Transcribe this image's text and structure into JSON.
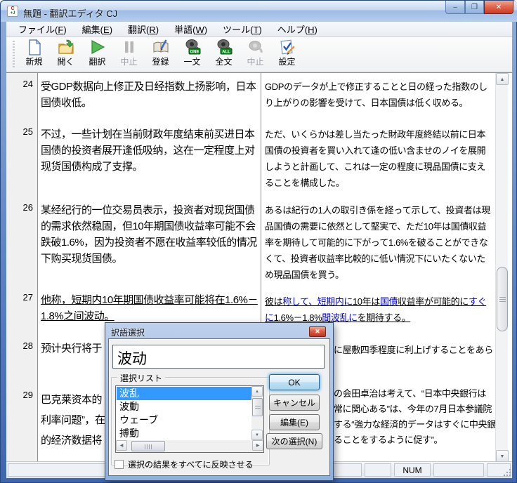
{
  "window": {
    "title": "無題 - 翻訳エディタ CJ",
    "controls": {
      "minimize": "–",
      "maximize": "❐",
      "close": "✕"
    }
  },
  "menu": {
    "items": [
      {
        "pre": "ファイル",
        "key": "F"
      },
      {
        "pre": "編集",
        "key": "E"
      },
      {
        "pre": "翻訳",
        "key": "R"
      },
      {
        "pre": "単語",
        "key": "W"
      },
      {
        "pre": "ツール",
        "key": "T"
      },
      {
        "pre": "ヘルプ",
        "key": "H"
      }
    ]
  },
  "toolbar": {
    "buttons": [
      {
        "label": "新規",
        "icon": "new-document-icon",
        "enabled": true
      },
      {
        "label": "開く",
        "icon": "open-folder-icon",
        "enabled": true
      },
      {
        "label": "翻訳",
        "icon": "translate-play-icon",
        "enabled": true
      },
      {
        "label": "中止",
        "icon": "pause-icon",
        "enabled": false
      },
      {
        "label": "登録",
        "icon": "register-book-icon",
        "enabled": true
      },
      {
        "label": "一文",
        "icon": "speak-one-icon",
        "badge": "ONE",
        "enabled": true
      },
      {
        "label": "全文",
        "icon": "speak-all-icon",
        "badge": "ALL",
        "enabled": true
      },
      {
        "label": "中止",
        "icon": "stop-speech-icon",
        "enabled": false
      },
      {
        "label": "設定",
        "icon": "settings-check-icon",
        "enabled": true
      }
    ]
  },
  "editor": {
    "rows": [
      {
        "num": "24",
        "source": "受GDP数据向上修正及日经指数上扬影响，日本国债收低。",
        "target": "GDPのデータが上で修正することと日の経った指数のしり上がりの影響を受けて、日本国債は低く収める。"
      },
      {
        "num": "25",
        "source": "不过，一些计划在当前财政年度结束前买进日本国债的投资者展开逢低吸纳，这在一定程度上对现货国债构成了支撑。",
        "target": "ただ、いくらかは差し当たった財政年度終結以前に日本国債の投資者を買い入れて逢の低い含ませのノイを展開しようと計画して、これは一定の程度に現品国債に支えることを構成した。"
      },
      {
        "num": "26",
        "source": "某经纪行的一位交易员表示，投资者对现货国债的需求依然稳固，但10年期国债收益率可能不会跌破1.6%，因为投资者不愿在收益率较低的情况下购买现货国债。",
        "target": "あるは紀行の1人の取引き係を経って示して、投資者は現品国債の需要に依然として堅実で、ただ10年は国債収益率を期待して可能的に下がって1.6%を破ることができなくて、投資者収益率比較的に低い情況下にいたくないため現品国債を買う。"
      },
      {
        "num": "27",
        "source": "他称，短期内10年期国债收益率可能将在1.6%－1.8%之间波动。",
        "target_segments": [
          {
            "t": "彼は",
            "c": "#000000"
          },
          {
            "t": "称して、短期内に",
            "c": "#0000ee"
          },
          {
            "t": "10年は",
            "c": "#000000"
          },
          {
            "t": "国債",
            "c": "#0000ee"
          },
          {
            "t": "収益率が可能的に",
            "c": "#000000"
          },
          {
            "t": "すぐに",
            "c": "#0000ee"
          },
          {
            "t": "1.6%－1.8%",
            "c": "#000000"
          },
          {
            "t": "間波乱に",
            "c": "#0000ee"
          },
          {
            "t": "を期待する。",
            "c": "#000000"
          }
        ]
      },
      {
        "num": "28",
        "source_fragment": "预计央行将于",
        "target_fragment": "に屋敷四季程度に利上げすることをあら"
      },
      {
        "num": "29",
        "source_lines": "巴克莱资本的\n利率问题”，在\n的经济数据将",
        "target_lines": "の会田卓治は考えて、“日本中央銀行は\n常に関心ある”は、今年の7月日本参議院\nする“強力な経済的データはすぐに中央銀\nることをするように促す”。"
      }
    ]
  },
  "dialog": {
    "title": "訳語選択",
    "close_glyph": "✕",
    "input_value": "波动",
    "group_label": "選択リスト",
    "list_items": [
      "波乱",
      "波動",
      "ウェーブ",
      "搏動"
    ],
    "selected_index": 0,
    "buttons": {
      "ok": "OK",
      "cancel": "キャンセル",
      "edit": "編集(E)",
      "next": "次の選択(N)"
    },
    "checkbox_label": "選択の結果をすべてに反映させる",
    "checkbox_checked": false,
    "selection_color": "#3399ff"
  },
  "statusbar": {
    "num_label": "NUM"
  },
  "icons": {
    "up": "▲",
    "down": "▼",
    "left": "◀",
    "right": "▶"
  }
}
